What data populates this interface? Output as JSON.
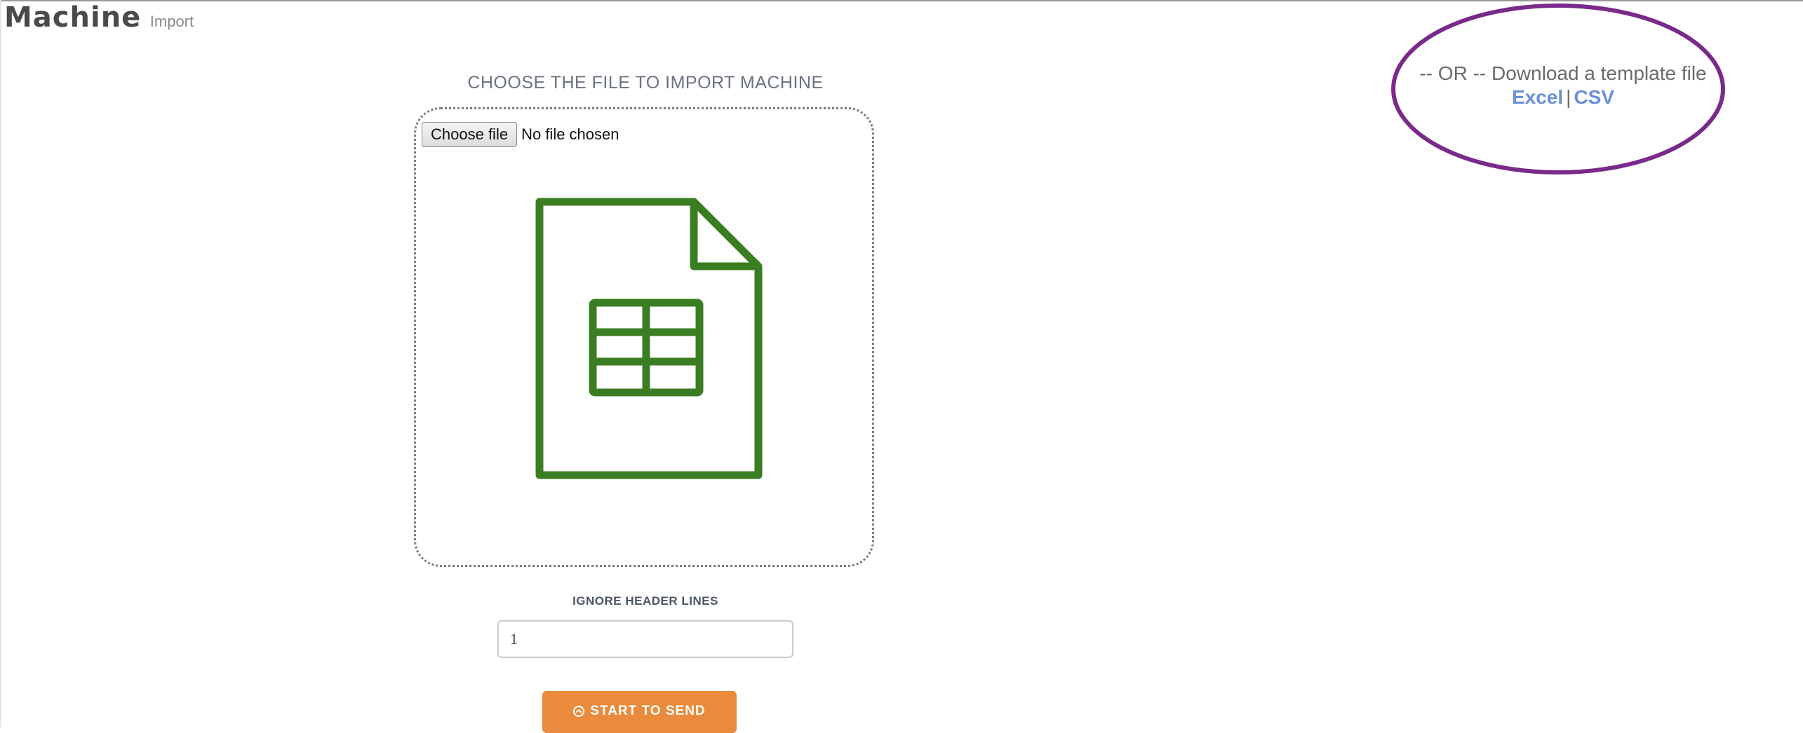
{
  "header": {
    "title": "Machine",
    "subtitle": "Import"
  },
  "import": {
    "section_title": "CHOOSE THE FILE TO IMPORT MACHINE",
    "choose_file_label": "Choose file",
    "file_status": "No file chosen",
    "icon": "spreadsheet-file-icon"
  },
  "settings": {
    "ignore_header_label": "IGNORE HEADER LINES",
    "ignore_header_value": "1"
  },
  "actions": {
    "start_label": "START TO SEND",
    "start_icon": "arrow-up-circle-icon"
  },
  "template": {
    "text": "-- OR -- Download a template file",
    "excel_label": "Excel",
    "separator": "|",
    "csv_label": "CSV"
  },
  "colors": {
    "icon_green": "#3b7d23",
    "button_orange": "#e98a3c",
    "link_blue": "#6a8fd8",
    "annotation_purple": "#7a2a8a"
  }
}
